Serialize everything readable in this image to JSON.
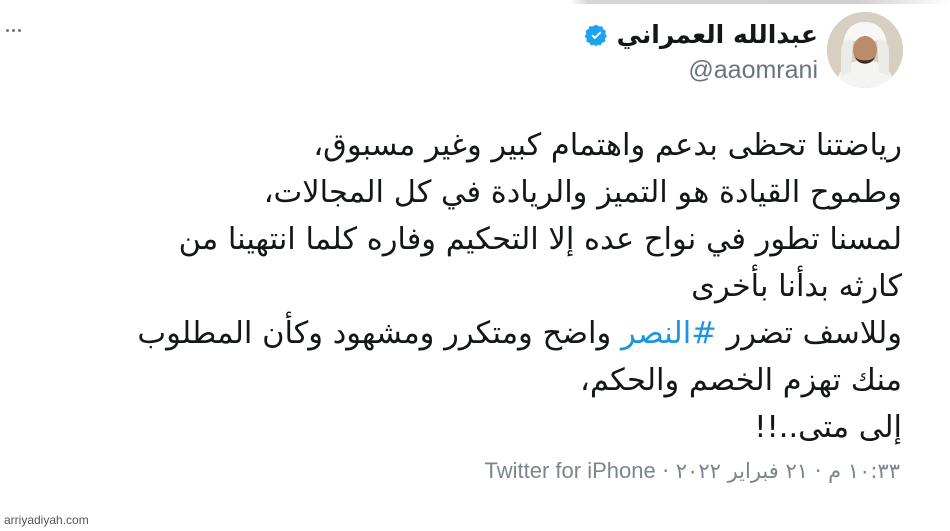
{
  "tweet": {
    "author": {
      "display_name": "عبدالله العمراني",
      "handle": "@aaomrani",
      "verified": true,
      "verified_icon": "verified-badge-icon",
      "avatar_icon": "avatar-photo"
    },
    "more_icon": "more-dots-icon",
    "text_lines": [
      "رياضتنا تحظى بدعم واهتمام كبير وغير مسبوق،",
      "وطموح القيادة هو التميز والريادة في كل المجالات،",
      "لمسنا تطور في نواح عده إلا التحكيم وفاره كلما انتهينا من",
      "كارثه بدأنا بأخرى"
    ],
    "line5": {
      "before": "وللاسف تضرر ",
      "hashtag": "#النصر",
      "after": " واضح ومتكرر ومشهود وكأن المطلوب"
    },
    "text_lines_end": [
      "منك تهزم الخصم والحكم،",
      "إلى متى..!!"
    ],
    "meta": {
      "time": "١٠:٣٣ م",
      "separator": "·",
      "date": "٢١ فبراير ٢٠٢٢",
      "source": "Twitter for iPhone"
    }
  },
  "colors": {
    "text": "#14171a",
    "secondary": "#66757f",
    "link": "#1b95e0",
    "verified": "#1da1f2"
  },
  "watermark": "arriyadiyah.com"
}
